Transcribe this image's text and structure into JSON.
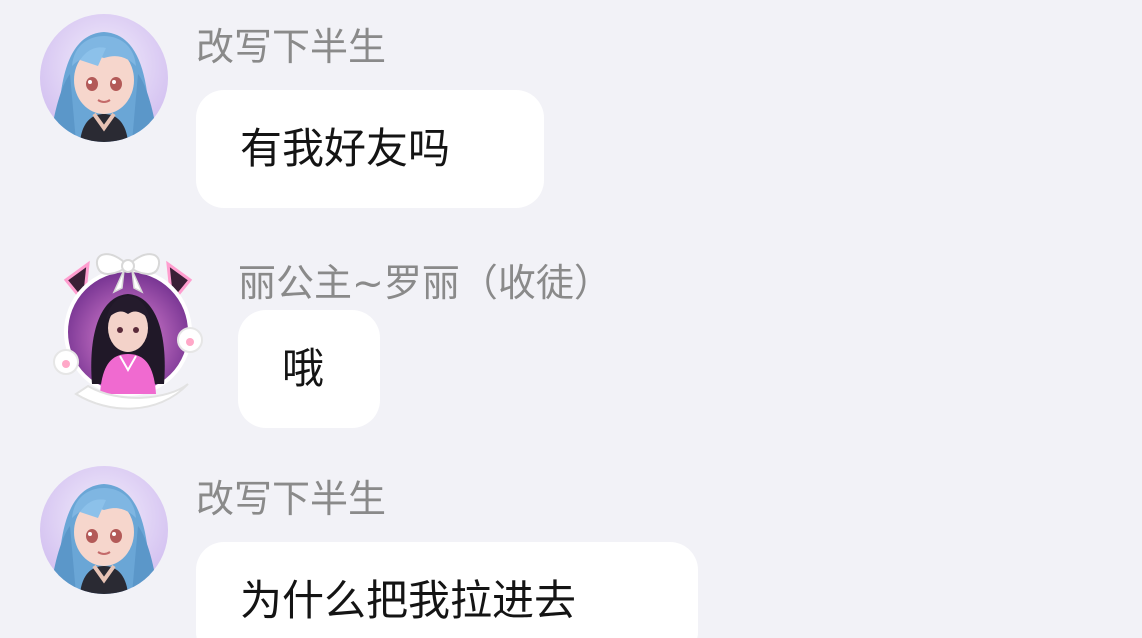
{
  "messages": [
    {
      "sender": "改写下半生",
      "text": "有我好友吗",
      "avatar_icon": "anime-girl-blue-hair-avatar"
    },
    {
      "sender": "丽公主~罗丽（收徒）",
      "text": "哦",
      "avatar_icon": "anime-girl-cat-ear-frame-avatar"
    },
    {
      "sender": "改写下半生",
      "text": "为什么把我拉进去",
      "avatar_icon": "anime-girl-blue-hair-avatar"
    }
  ],
  "colors": {
    "background": "#f2f2f7",
    "bubble": "#ffffff",
    "name_text": "#8a8a8a",
    "message_text": "#141414"
  }
}
